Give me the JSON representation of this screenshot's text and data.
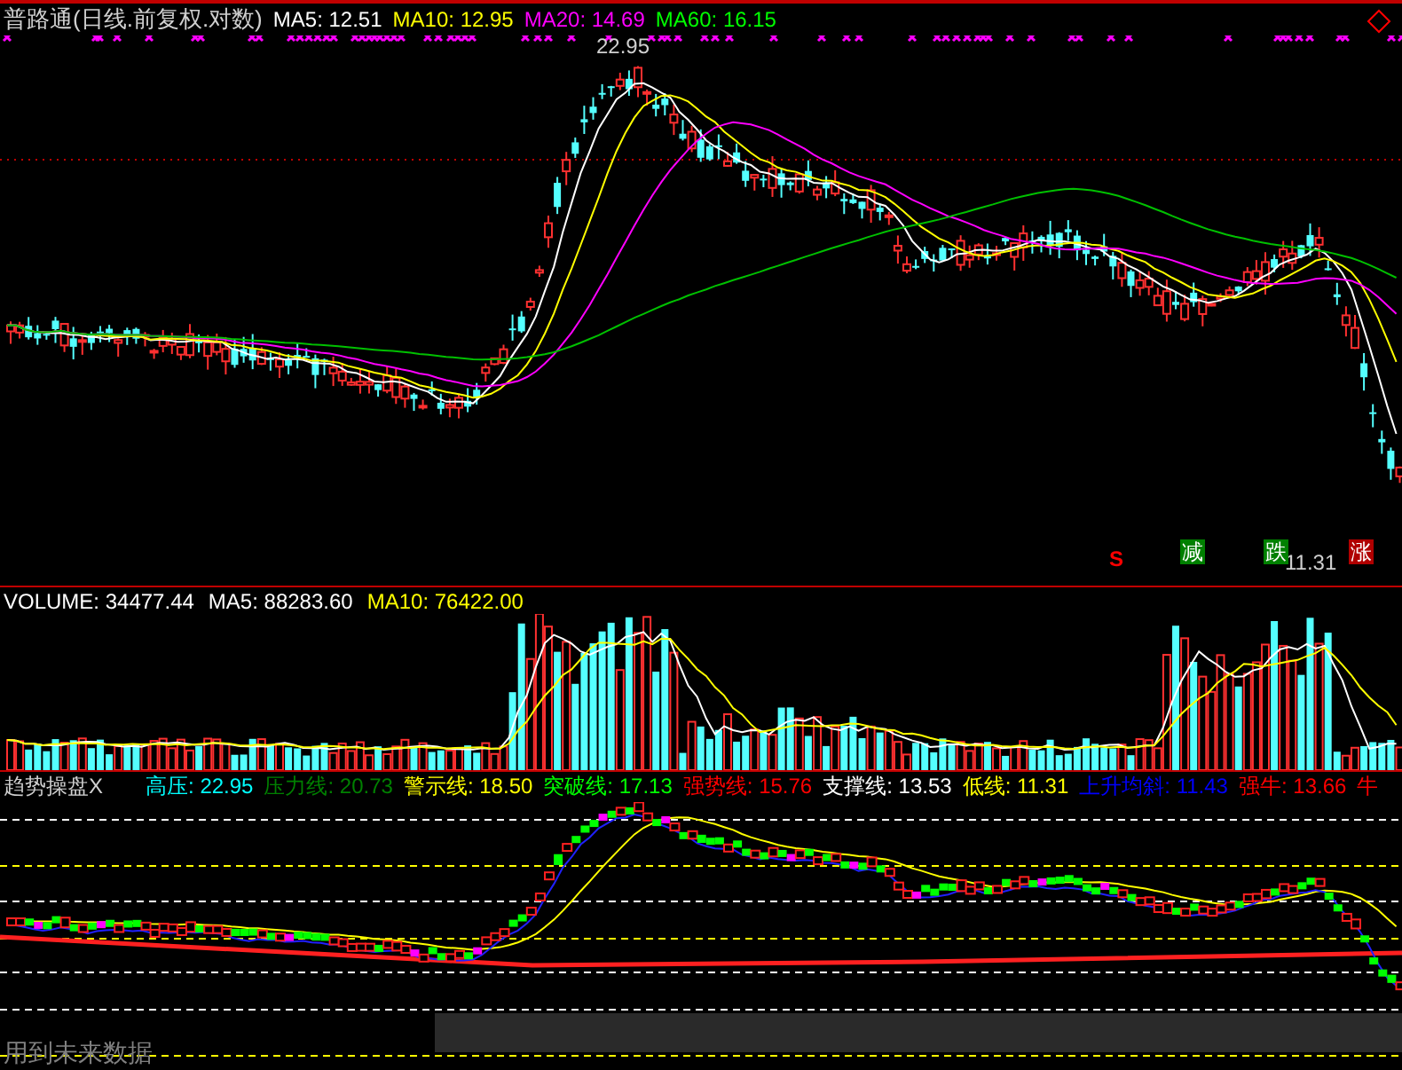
{
  "title": "普路通(日线.前复权.对数)",
  "main_legend": [
    {
      "label": "MA5:",
      "value": "12.51",
      "color": "#ffffff"
    },
    {
      "label": "MA10:",
      "value": "12.95",
      "color": "#ffff00"
    },
    {
      "label": "MA20:",
      "value": "14.69",
      "color": "#ff00ff"
    },
    {
      "label": "MA60:",
      "value": "16.15",
      "color": "#00ff00"
    }
  ],
  "high_label": "22.95",
  "low_label": "11.31",
  "signals": [
    {
      "text": "S",
      "kind": "plain",
      "color": "#ff0000"
    },
    {
      "text": "减",
      "kind": "badge",
      "color": "#008000"
    },
    {
      "text": "跌",
      "kind": "badge",
      "color": "#008000"
    },
    {
      "text": "涨",
      "kind": "badge",
      "color": "#b00000"
    }
  ],
  "volume_legend": [
    {
      "label": "VOLUME:",
      "value": "34477.44",
      "color": "#ffffff"
    },
    {
      "label": "MA5:",
      "value": "88283.60",
      "color": "#ffffff"
    },
    {
      "label": "MA10:",
      "value": "76422.00",
      "color": "#ffff00"
    }
  ],
  "indicator_title": "趋势操盘X",
  "indicator_legend": [
    {
      "label": "高压:",
      "value": "22.95",
      "color": "#00ffff"
    },
    {
      "label": "压力线:",
      "value": "20.73",
      "color": "#008000"
    },
    {
      "label": "警示线:",
      "value": "18.50",
      "color": "#ffff00"
    },
    {
      "label": "突破线:",
      "value": "17.13",
      "color": "#00ff00"
    },
    {
      "label": "强势线:",
      "value": "15.76",
      "color": "#ff0000"
    },
    {
      "label": "支撑线:",
      "value": "13.53",
      "color": "#ffffff"
    },
    {
      "label": "低线:",
      "value": "11.31",
      "color": "#ffff00"
    },
    {
      "label": "上升均斜:",
      "value": "11.43",
      "color": "#0000ff"
    },
    {
      "label": "强牛:",
      "value": "13.66",
      "color": "#ff0000"
    },
    {
      "label": "牛",
      "color": "#ff0000"
    }
  ],
  "future_data_note": "用到未来数据"
}
